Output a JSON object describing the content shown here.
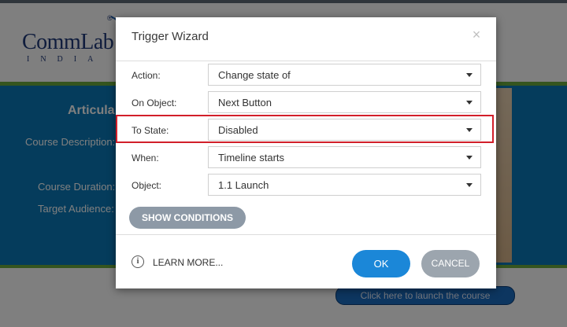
{
  "background_slide": {
    "logo_main": "CommLab",
    "logo_sub": "INDIA",
    "logo_reg": "®",
    "title": "Articula",
    "labels": [
      "Course Description:",
      "Course Duration:",
      "Target Audience:"
    ],
    "launch_button": "Click here to launch the course",
    "colors": {
      "band": "#0b79b8",
      "accent_line": "#6bab3e"
    }
  },
  "dialog": {
    "title": "Trigger Wizard",
    "close_glyph": "×",
    "rows": [
      {
        "label": "Action:",
        "value": "Change state of"
      },
      {
        "label": "On Object:",
        "value": "Next Button"
      },
      {
        "label": "To State:",
        "value": "Disabled"
      },
      {
        "label": "When:",
        "value": "Timeline starts"
      },
      {
        "label": "Object:",
        "value": "1.1 Launch"
      }
    ],
    "highlighted_row": "To State:",
    "show_conditions": "SHOW CONDITIONS",
    "learn_more": "LEARN MORE...",
    "learn_icon_glyph": "i",
    "ok": "OK",
    "cancel": "CANCEL",
    "colors": {
      "ok": "#1b87d8",
      "cancel": "#9ca5ae",
      "highlight": "#d21f2a"
    }
  }
}
